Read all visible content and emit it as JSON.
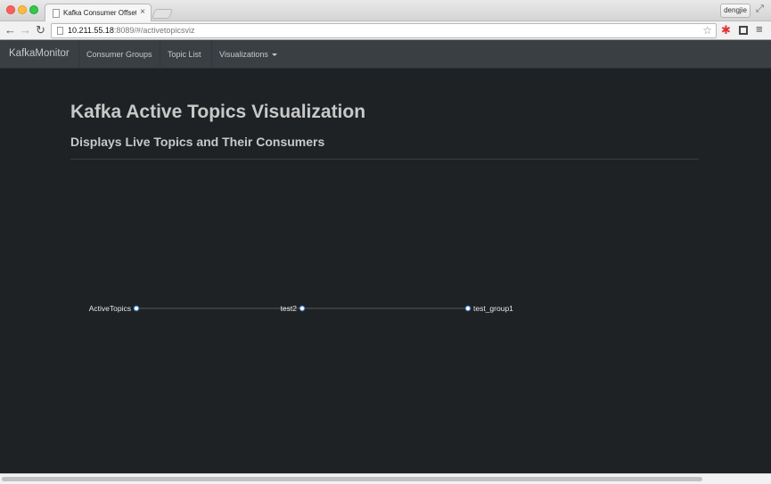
{
  "browser": {
    "tab_title": "Kafka Consumer Offset Mo",
    "tab_close": "×",
    "profile_name": "dengjie",
    "url_host": "10.211.55.18",
    "url_rest": ":8089/#/activetopicsviz"
  },
  "navbar": {
    "brand": "KafkaMonitor",
    "items": [
      {
        "label": "Consumer Groups"
      },
      {
        "label": "Topic List"
      },
      {
        "label": "Visualizations"
      }
    ]
  },
  "header": {
    "title": "Kafka Active Topics Visualization",
    "subtitle": "Displays Live Topics and Their Consumers"
  },
  "tree": {
    "nodes": [
      {
        "label": "ActiveTopics"
      },
      {
        "label": "test2"
      },
      {
        "label": "test_group1"
      }
    ]
  },
  "colors": {
    "background": "#1f2224",
    "navbar": "#3a3f44",
    "node_fill": "#ffffff",
    "node_stroke": "#4e8fd8",
    "link": "#555a5e"
  },
  "icons": {
    "back": "arrow-left-icon",
    "forward": "arrow-right-icon",
    "reload": "reload-icon",
    "star": "star-icon",
    "menu": "hamburger-menu-icon"
  }
}
